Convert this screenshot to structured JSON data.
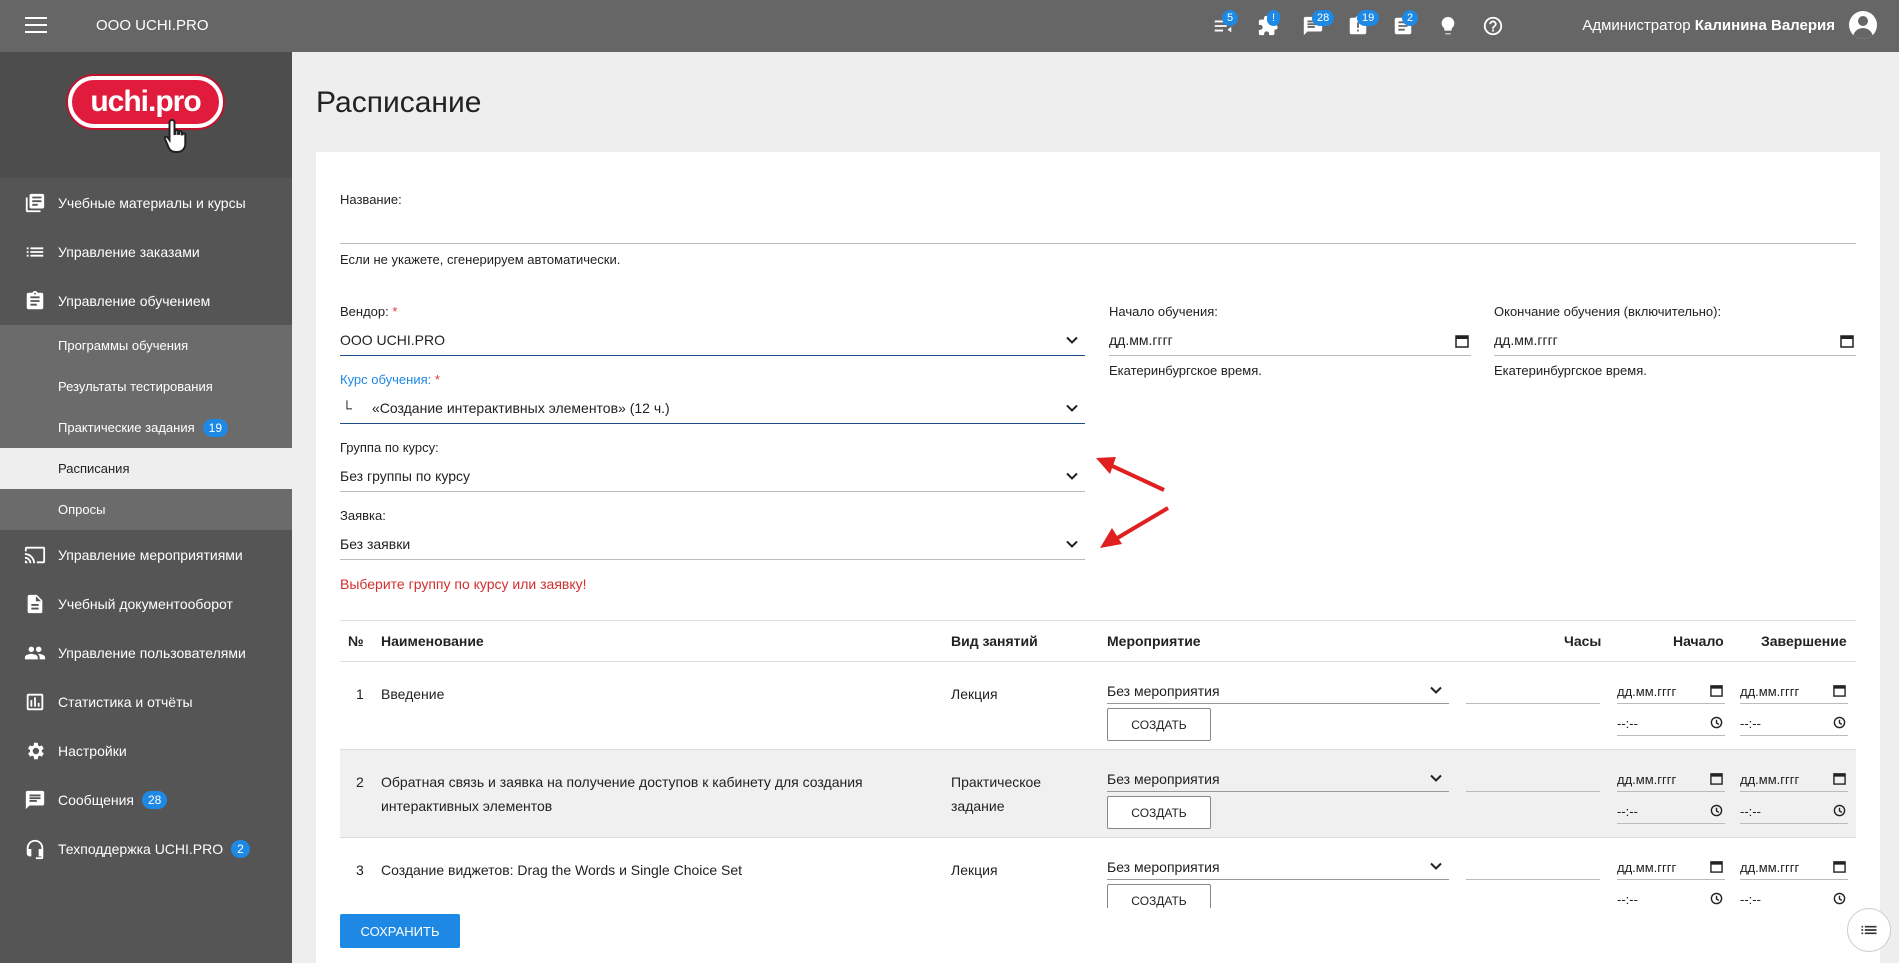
{
  "topbar": {
    "brand": "ООО UCHI.PRO",
    "icons": [
      {
        "name": "list-icon",
        "badge": "5"
      },
      {
        "name": "puzzle-icon",
        "badge": "!"
      },
      {
        "name": "chat-icon",
        "badge": "28"
      },
      {
        "name": "tasks-icon",
        "badge": "19"
      },
      {
        "name": "document-icon",
        "badge": "2"
      },
      {
        "name": "lightbulb-icon",
        "badge": ""
      },
      {
        "name": "help-icon",
        "badge": ""
      }
    ],
    "role": "Администратор",
    "user": "Калинина Валерия"
  },
  "sidebar": {
    "logo": "uchi.pro",
    "items": [
      {
        "label": "Учебные материалы и курсы",
        "icon": "book-icon"
      },
      {
        "label": "Управление заказами",
        "icon": "list-icon"
      },
      {
        "label": "Управление обучением",
        "icon": "clipboard-icon"
      }
    ],
    "sub": [
      {
        "label": "Программы обучения",
        "badge": ""
      },
      {
        "label": "Результаты тестирования",
        "badge": ""
      },
      {
        "label": "Практические задания",
        "badge": "19"
      },
      {
        "label": "Расписания",
        "badge": ""
      },
      {
        "label": "Опросы",
        "badge": ""
      }
    ],
    "items2": [
      {
        "label": "Управление мероприятиями",
        "icon": "cast-icon",
        "badge": ""
      },
      {
        "label": "Учебный документооборот",
        "icon": "file-icon",
        "badge": ""
      },
      {
        "label": "Управление пользователями",
        "icon": "people-icon",
        "badge": ""
      },
      {
        "label": "Статистика и отчёты",
        "icon": "chart-icon",
        "badge": ""
      },
      {
        "label": "Настройки",
        "icon": "gear-icon",
        "badge": ""
      },
      {
        "label": "Сообщения",
        "icon": "message-icon",
        "badge": "28"
      },
      {
        "label": "Техподдержка UCHI.PRO",
        "icon": "support-icon",
        "badge": "2"
      }
    ]
  },
  "page": {
    "title": "Расписание",
    "name_label": "Название:",
    "name_hint": "Если не укажете, сгенерируем автоматически.",
    "vendor_label": "Вендор:",
    "vendor_value": "ООО UCHI.PRO",
    "start_label": "Начало обучения:",
    "start_placeholder": "дд.мм.гггг",
    "start_hint": "Екатеринбургское время.",
    "end_label": "Окончание обучения (включительно):",
    "end_placeholder": "дд.мм.гггг",
    "end_hint": "Екатеринбургское время.",
    "course_label": "Курс обучения:",
    "course_prefix": "└",
    "course_value": "«Создание интерактивных элементов» (12 ч.)",
    "group_label": "Группа по курсу:",
    "group_value": "Без группы по курсу",
    "request_label": "Заявка:",
    "request_value": "Без заявки",
    "error": "Выберите группу по курсу или заявку!",
    "required_mark": "*"
  },
  "table": {
    "headers": {
      "num": "№",
      "name": "Наименование",
      "type": "Вид занятий",
      "event": "Мероприятие",
      "hours": "Часы",
      "start": "Начало",
      "end": "Завершение"
    },
    "rows": [
      {
        "num": "1",
        "name": "Введение",
        "type": "Лекция",
        "event": "Без мероприятия",
        "create": "СОЗДАТЬ",
        "date": "дд.мм.гггг",
        "time": "--:--"
      },
      {
        "num": "2",
        "name": "Обратная связь и заявка на получение доступов к кабинету для создания интерактивных элементов",
        "type": "Практическое задание",
        "event": "Без мероприятия",
        "create": "СОЗДАТЬ",
        "date": "дд.мм.гггг",
        "time": "--:--"
      },
      {
        "num": "3",
        "name": "Создание виджетов: Drag the Words и Single Choice Set",
        "type": "Лекция",
        "event": "Без мероприятия",
        "create": "СОЗДАТЬ",
        "date": "дд.мм.гггг",
        "time": "--:--"
      }
    ]
  },
  "save_label": "СОХРАНИТЬ"
}
